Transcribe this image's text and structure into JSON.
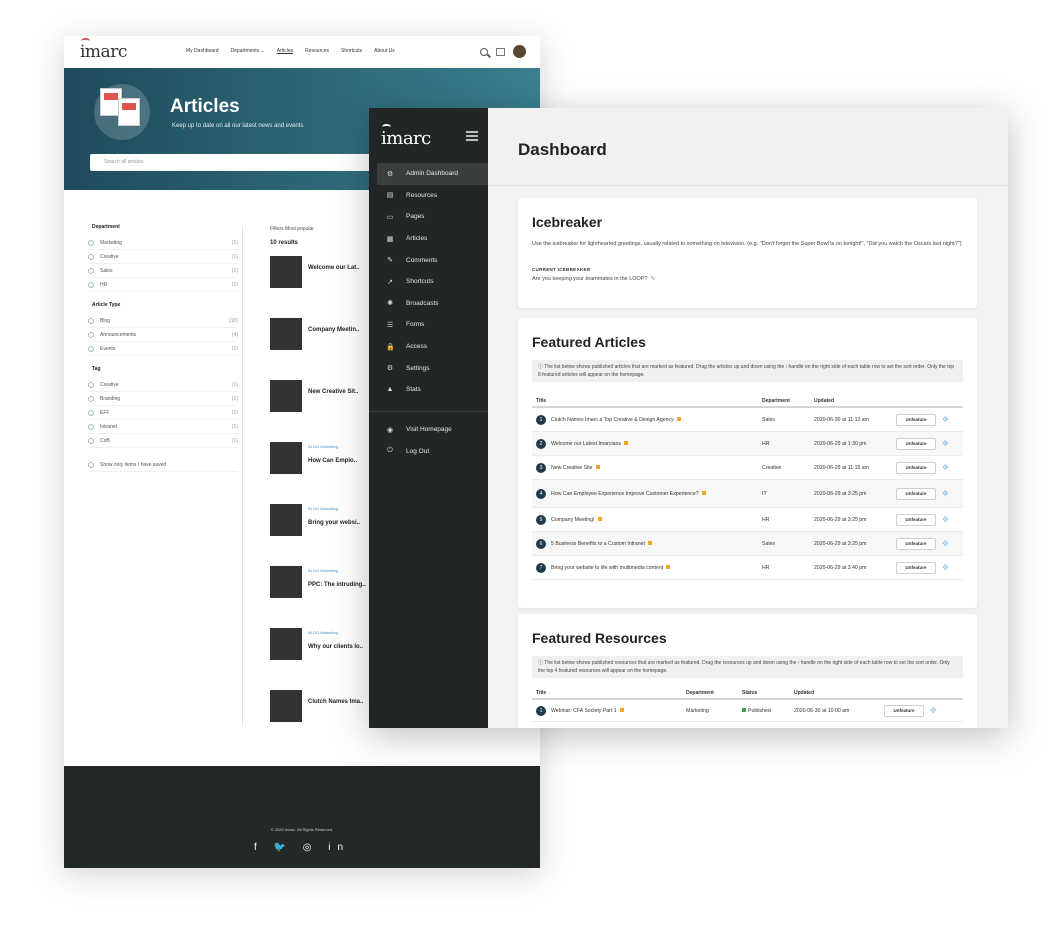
{
  "articles_page": {
    "logo": "imarc",
    "nav": [
      "My Dashboard",
      "Departments ⌄",
      "Articles",
      "Resources",
      "Shortcuts",
      "About Us"
    ],
    "hero": {
      "title": "Articles",
      "subtitle": "Keep up to date on all our latest news and events",
      "search_placeholder": "Search all articles"
    },
    "filters": [
      {
        "heading": "Department",
        "items": [
          {
            "label": "Marketing",
            "count": "(1)"
          },
          {
            "label": "Creative",
            "count": "(1)"
          },
          {
            "label": "Sales",
            "count": "(1)"
          },
          {
            "label": "HR",
            "count": "(1)"
          }
        ]
      },
      {
        "heading": "Article Type",
        "items": [
          {
            "label": "Blog",
            "count": "(10)"
          },
          {
            "label": "Announcements",
            "count": "(4)"
          },
          {
            "label": "Events",
            "count": "(1)"
          }
        ]
      },
      {
        "heading": "Tag",
        "items": [
          {
            "label": "Creative",
            "count": "(1)"
          },
          {
            "label": "Branding",
            "count": "(1)"
          },
          {
            "label": "EFF",
            "count": "(1)"
          },
          {
            "label": "Intranet",
            "count": "(1)"
          },
          {
            "label": "CoB",
            "count": "(1)"
          }
        ]
      }
    ],
    "show_saved": "Show only items I have saved",
    "results_sort": "Filters   Most popular",
    "results_count": "10 results",
    "results": [
      {
        "title": "Welcome our Lat..",
        "tag": ""
      },
      {
        "title": "Company Meetin..",
        "tag": ""
      },
      {
        "title": "New Creative Sit..",
        "tag": ""
      },
      {
        "title": "How Can Emplo..",
        "tag": "BLOG  Marketing"
      },
      {
        "title": "Bring your websi..",
        "tag": "BLOG  Marketing"
      },
      {
        "title": "PPC: The intruding..",
        "tag": "BLOG  Marketing"
      },
      {
        "title": "Why our clients lo..",
        "tag": "BLOG  Marketing"
      },
      {
        "title": "Clutch Names Ima..",
        "tag": ""
      }
    ],
    "footer_copy": "© 2020 Imarc. All Rights Reserved.",
    "footer_social": "f 🐦 ◎ in"
  },
  "dashboard": {
    "logo": "imarc",
    "menu": [
      {
        "label": "Admin Dashboard",
        "icon": "⚙"
      },
      {
        "label": "Resources",
        "icon": "▤"
      },
      {
        "label": "Pages",
        "icon": "▭"
      },
      {
        "label": "Articles",
        "icon": "▦"
      },
      {
        "label": "Comments",
        "icon": "✎"
      },
      {
        "label": "Shortcuts",
        "icon": "↗"
      },
      {
        "label": "Broadcasts",
        "icon": "✺"
      },
      {
        "label": "Forms",
        "icon": "☰"
      },
      {
        "label": "Access",
        "icon": "🔒"
      },
      {
        "label": "Settings",
        "icon": "⚙"
      },
      {
        "label": "Stats",
        "icon": "▲"
      }
    ],
    "menu2": [
      {
        "label": "Visit Homepage",
        "icon": "◉"
      },
      {
        "label": "Log Out",
        "icon": "⏻"
      }
    ],
    "title": "Dashboard",
    "icebreaker": {
      "title": "Icebreaker",
      "description": "Use the icebreaker for lighthearted greetings, usually related to something on television. (e.g. \"Don't forget the Super Bowl is on tonight!\", \"Did you watch the Oscars last night?\")",
      "current_label": "CURRENT ICEBREAKER",
      "current_value": "Are you keeping your teammates in the LOOP?",
      "edit_icon": "✎"
    },
    "featured_articles": {
      "title": "Featured Articles",
      "info": "ⓘ The list below shows published articles that are marked as featured. Drag the articles up and down using the ⁝ handle on the right side of each table row to set the sort order. Only the top 8 featured articles will appear on the homepage.",
      "headers": [
        "Title",
        "Department",
        "Updated"
      ],
      "button_label": "Unfeature",
      "rows": [
        {
          "num": "1",
          "title": "Clutch Names Imarc a Top Creative & Design Agency",
          "dept": "Sales",
          "updated": "2020-06-30 at 11:12 am"
        },
        {
          "num": "2",
          "title": "Welcome our Latest Imarcians",
          "dept": "HR",
          "updated": "2020-06-29 at 1:30 pm"
        },
        {
          "num": "3",
          "title": "New Creative Site",
          "dept": "Creative",
          "updated": "2020-06-29 at 11:15 am"
        },
        {
          "num": "4",
          "title": "How Can Employee Experience Improve Customer Experience?",
          "dept": "IT",
          "updated": "2020-06-29 at 3:25 pm"
        },
        {
          "num": "5",
          "title": "Company Meeting!",
          "dept": "HR",
          "updated": "2020-06-29 at 3:25 pm"
        },
        {
          "num": "6",
          "title": "5 Business Benefits to a Custom Intranet",
          "dept": "Sales",
          "updated": "2020-06-29 at 3:25 pm"
        },
        {
          "num": "7",
          "title": "Bring your website to life with multimedia content",
          "dept": "HR",
          "updated": "2020-06-29 at 3:40 pm"
        }
      ]
    },
    "featured_resources": {
      "title": "Featured Resources",
      "info": "ⓘ The list below shows published resources that are marked as featured. Drag the resources up and down using the ⁝ handle on the right side of each table row to set the sort order. Only the top 4 featured resources will appear on the homepage.",
      "headers": [
        "Title",
        "Department",
        "Status",
        "Updated"
      ],
      "button_label": "Unfeature",
      "rows": [
        {
          "num": "1",
          "title": "Webinar: CFA Society Part 1",
          "dept": "Marketing",
          "status": "Published",
          "updated": "2020-06-30 at 10:00 am"
        }
      ]
    }
  }
}
